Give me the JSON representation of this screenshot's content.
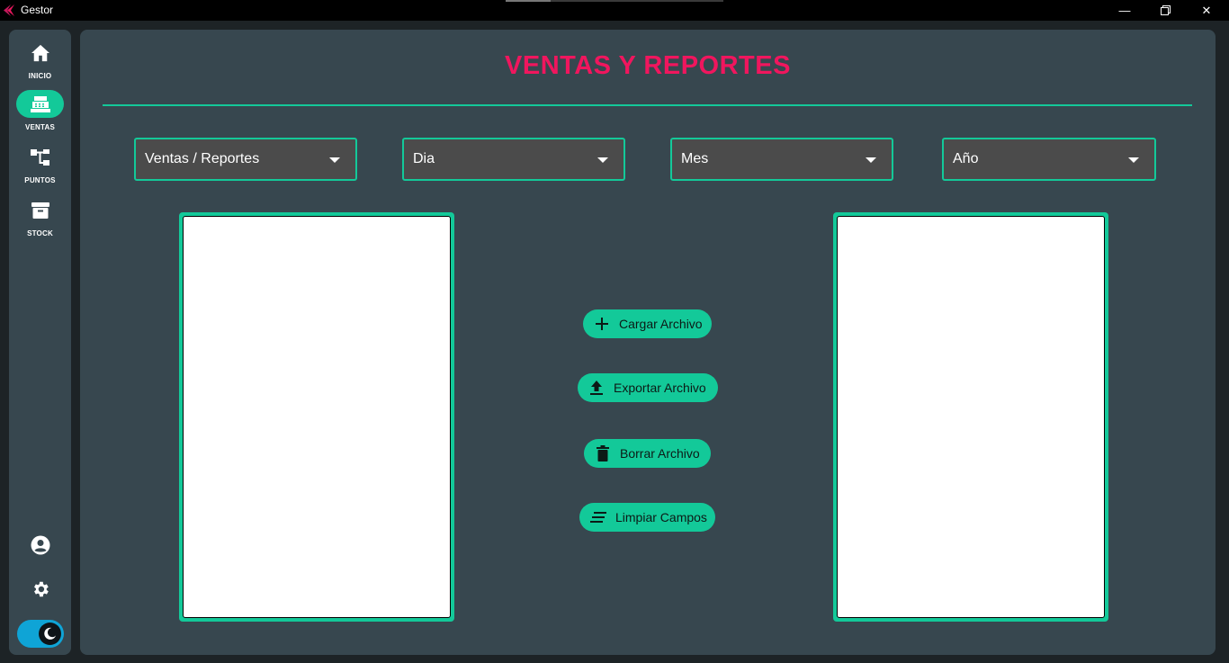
{
  "window": {
    "title": "Gestor",
    "minimize_glyph": "—",
    "restore_glyph": "❐",
    "close_glyph": "✕"
  },
  "sidebar": {
    "items": [
      {
        "label": "INICIO",
        "icon": "home-icon",
        "active": false
      },
      {
        "label": "VENTAS",
        "icon": "cash-register-icon",
        "active": true
      },
      {
        "label": "PUNTOS",
        "icon": "network-icon",
        "active": false
      },
      {
        "label": "STOCK",
        "icon": "archive-box-icon",
        "active": false
      }
    ],
    "bottom": [
      "account-icon",
      "gear-icon",
      "dark-mode-toggle"
    ]
  },
  "main": {
    "title": "VENTAS Y REPORTES",
    "dropdowns": [
      {
        "value": "Ventas / Reportes"
      },
      {
        "value": "Dia"
      },
      {
        "value": "Mes"
      },
      {
        "value": "Año"
      }
    ],
    "buttons": {
      "load": "Cargar Archivo",
      "export": "Exportar Archivo",
      "delete": "Borrar Archivo",
      "clear": "Limpiar Campos"
    }
  },
  "colors": {
    "accent": "#13c999",
    "title": "#f0165e",
    "panel": "#37474f",
    "background": "#1d2326",
    "toggle": "#0fa4d6"
  }
}
